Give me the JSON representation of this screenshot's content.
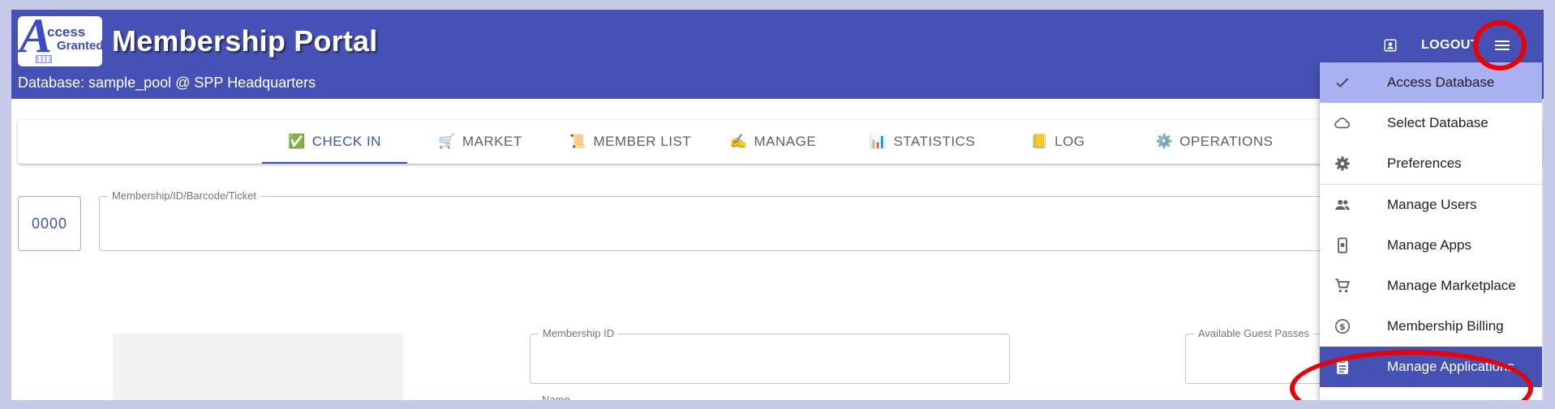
{
  "header": {
    "logo": {
      "big_letter": "A",
      "line1": "ccess",
      "line2": "Granted"
    },
    "title": "Membership Portal",
    "database_line": "Database: sample_pool @ SPP Headquarters",
    "logout_label": "LOGOUT",
    "account_icon": "account-box-icon",
    "menu_icon": "hamburger-menu-icon"
  },
  "tabs": [
    {
      "label": "CHECK IN",
      "icon": "✅",
      "active": true
    },
    {
      "label": "MARKET",
      "icon": "🛒"
    },
    {
      "label": "MEMBER LIST",
      "icon": "📜"
    },
    {
      "label": "MANAGE",
      "icon": "✍️"
    },
    {
      "label": "STATISTICS",
      "icon": "📊"
    },
    {
      "label": "LOG",
      "icon": "📒"
    },
    {
      "label": "OPERATIONS",
      "icon": "⚙️"
    }
  ],
  "checkin": {
    "counter_value": "0000",
    "membership_input_label": "Membership/ID/Barcode/Ticket",
    "membership_id_label": "Membership ID",
    "guest_passes_label": "Available Guest Passes",
    "name_label": "Name"
  },
  "menu": {
    "items": [
      {
        "label": "Access Database",
        "icon": "check-icon",
        "state": "highlighted"
      },
      {
        "label": "Select Database",
        "icon": "cloud-icon"
      },
      {
        "label": "Preferences",
        "icon": "gear-icon"
      },
      {
        "label": "Manage Users",
        "icon": "people-icon"
      },
      {
        "label": "Manage Apps",
        "icon": "phone-app-icon"
      },
      {
        "label": "Manage Marketplace",
        "icon": "cart-icon"
      },
      {
        "label": "Membership Billing",
        "icon": "dollar-circle-icon"
      },
      {
        "label": "Manage Applications",
        "icon": "clipboard-icon",
        "state": "selected"
      }
    ]
  },
  "colors": {
    "header_bg": "#4651b5",
    "accent": "#3f51b5",
    "menu_highlight": "#a9b1f2",
    "annotation": "#ee0000"
  }
}
